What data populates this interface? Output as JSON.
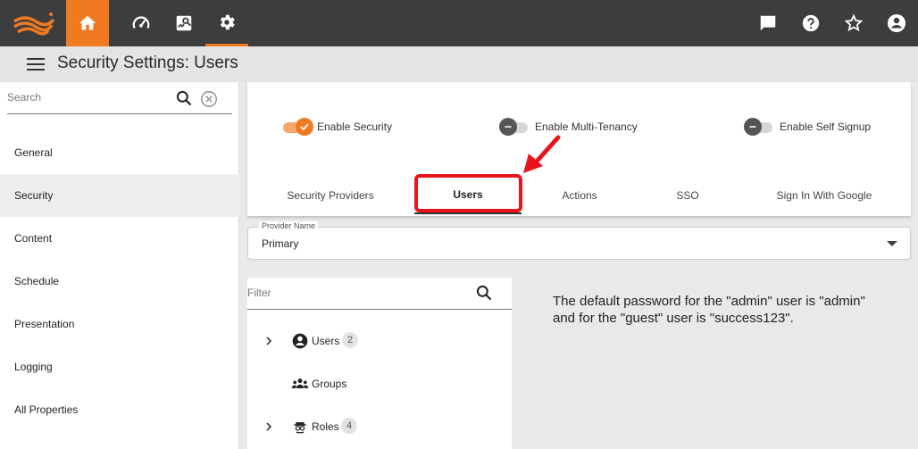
{
  "header": {
    "title": "Security Settings: Users"
  },
  "sidebar": {
    "search_placeholder": "Search",
    "items": [
      {
        "label": "General",
        "active": false
      },
      {
        "label": "Security",
        "active": true
      },
      {
        "label": "Content",
        "active": false
      },
      {
        "label": "Schedule",
        "active": false
      },
      {
        "label": "Presentation",
        "active": false
      },
      {
        "label": "Logging",
        "active": false
      },
      {
        "label": "All Properties",
        "active": false
      }
    ]
  },
  "toggles": [
    {
      "label": "Enable Security",
      "on": true
    },
    {
      "label": "Enable Multi-Tenancy",
      "on": false
    },
    {
      "label": "Enable Self Signup",
      "on": false
    }
  ],
  "tabs": [
    {
      "label": "Security Providers",
      "active": false
    },
    {
      "label": "Users",
      "active": true
    },
    {
      "label": "Actions",
      "active": false
    },
    {
      "label": "SSO",
      "active": false
    },
    {
      "label": "Sign In With Google",
      "active": false
    }
  ],
  "provider": {
    "label": "Provider Name",
    "value": "Primary"
  },
  "tree": {
    "filter_placeholder": "Filter",
    "nodes": [
      {
        "label": "Users",
        "count": "2",
        "icon": "user-circle-icon",
        "expandable": true
      },
      {
        "label": "Groups",
        "count": "",
        "icon": "groups-icon",
        "expandable": false
      },
      {
        "label": "Roles",
        "count": "4",
        "icon": "roles-icon",
        "expandable": true
      }
    ]
  },
  "info": {
    "text": "The default password for the \"admin\" user is \"admin\" and for the \"guest\" user is \"success123\"."
  },
  "colors": {
    "accent": "#f07a22",
    "topbar": "#3d3d3d",
    "annotation": "#e8131b"
  },
  "icons": [
    "logo-icon",
    "home-icon",
    "dashboard-icon",
    "report-icon",
    "settings-icon",
    "message-icon",
    "help-icon",
    "star-icon",
    "account-icon",
    "menu-icon",
    "search-icon",
    "clear-icon",
    "chevron-right-icon",
    "dropdown-icon",
    "check-icon",
    "minus-icon"
  ]
}
